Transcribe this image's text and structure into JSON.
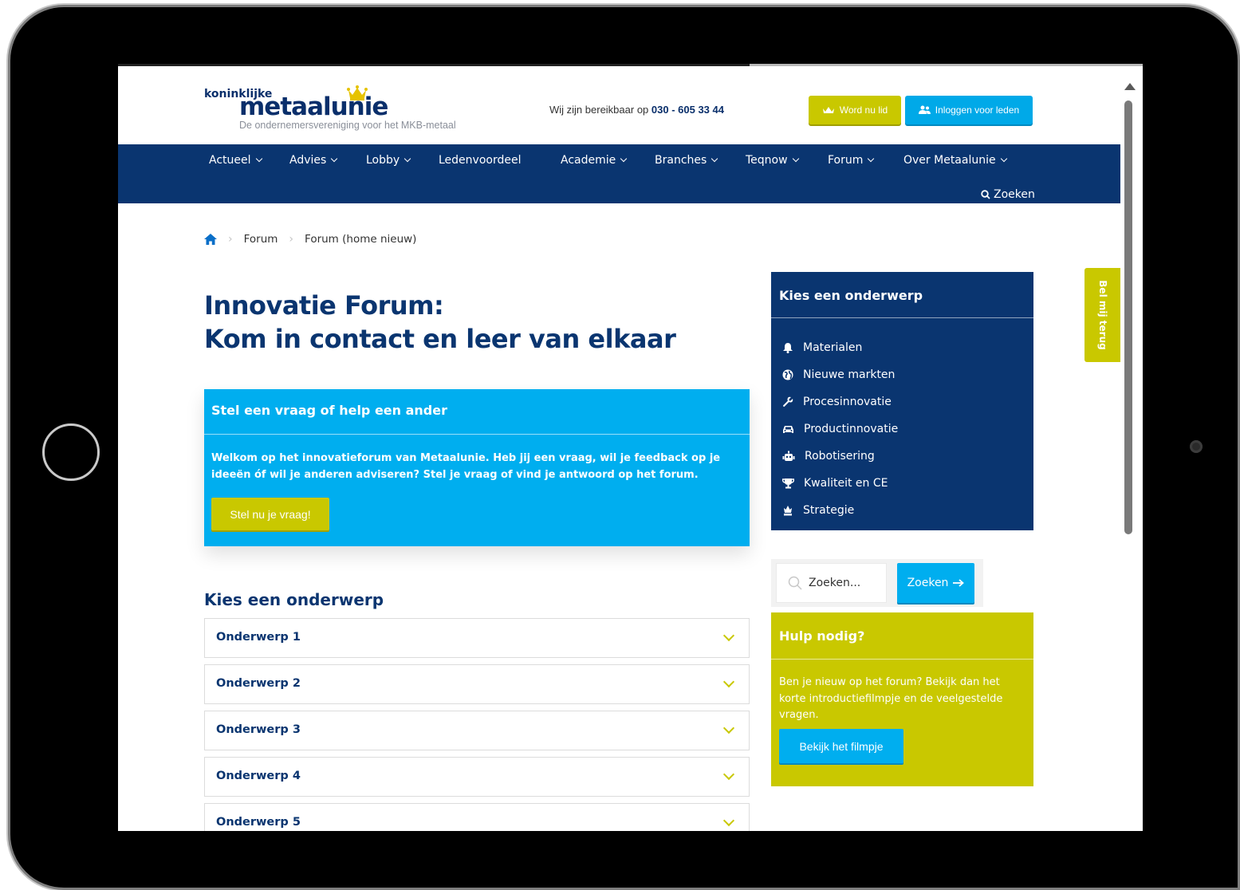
{
  "header": {
    "logo_small": "koninklijke",
    "logo_big": "metaalunie",
    "logo_tagline": "De ondernemersvereniging voor het MKB-metaal",
    "reach_text": "Wij zijn bereikbaar op",
    "phone": "030 - 605 33 44",
    "member_button": "Word nu lid",
    "login_button": "Inloggen voor leden"
  },
  "nav": {
    "items": [
      {
        "label": "Actueel",
        "dropdown": true
      },
      {
        "label": "Advies",
        "dropdown": true
      },
      {
        "label": "Lobby",
        "dropdown": true
      },
      {
        "label": "Ledenvoordeel",
        "dropdown": false
      },
      {
        "label": "Academie",
        "dropdown": true
      },
      {
        "label": "Branches",
        "dropdown": true
      },
      {
        "label": "Teqnow",
        "dropdown": true
      },
      {
        "label": "Forum",
        "dropdown": true
      },
      {
        "label": "Over Metaalunie",
        "dropdown": true
      }
    ],
    "search_label": "Zoeken"
  },
  "breadcrumb": {
    "items": [
      "Forum",
      "Forum (home nieuw)"
    ]
  },
  "page": {
    "title_line1": "Innovatie Forum:",
    "title_line2": "Kom in contact en leer van elkaar"
  },
  "ask_card": {
    "title": "Stel een vraag of help een ander",
    "text": "Welkom op het innovatieforum van Metaalunie. Heb jij een vraag, wil je feedback op je ideeën óf wil je anderen adviseren? Stel je vraag of vind je antwoord op het forum.",
    "button": "Stel nu je vraag!"
  },
  "topics": {
    "heading": "Kies een onderwerp",
    "items": [
      "Onderwerp 1",
      "Onderwerp 2",
      "Onderwerp 3",
      "Onderwerp 4",
      "Onderwerp 5"
    ]
  },
  "sidebar": {
    "topics_title": "Kies een onderwerp",
    "topics": [
      {
        "label": "Materialen",
        "icon": "bell-icon"
      },
      {
        "label": "Nieuwe markten",
        "icon": "globe-icon"
      },
      {
        "label": "Procesinnovatie",
        "icon": "wrench-icon"
      },
      {
        "label": "Productinnovatie",
        "icon": "car-icon"
      },
      {
        "label": "Robotisering",
        "icon": "robot-icon"
      },
      {
        "label": "Kwaliteit en CE",
        "icon": "trophy-icon"
      },
      {
        "label": "Strategie",
        "icon": "chess-icon"
      }
    ],
    "search_placeholder": "Zoeken...",
    "search_button": "Zoeken",
    "help_title": "Hulp nodig?",
    "help_text": "Ben je nieuw op het forum? Bekijk dan het korte introductiefilmpje en de veelgestelde vragen.",
    "help_button": "Bekijk het filmpje"
  },
  "callback_tab": "Bel mij terug",
  "colors": {
    "navy": "#0a3570",
    "cyan": "#00aeef",
    "lime": "#c9c800"
  }
}
